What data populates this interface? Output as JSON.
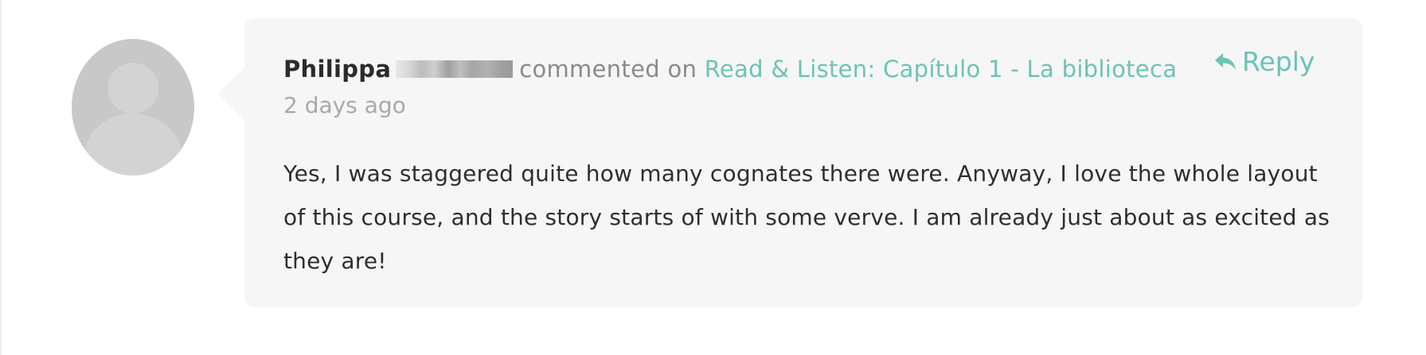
{
  "comment": {
    "author_first_name": "Philippa",
    "commented_on_text": "commented on",
    "lesson_link_text": "Read & Listen: Capítulo 1 - La biblioteca",
    "timestamp": "2 days ago",
    "body": "Yes, I was staggered quite how many cognates there were. Anyway, I love the whole layout of this course, and the story starts of with some verve. I am already just about as excited as they are!",
    "reply_label": "Reply"
  },
  "icons": {
    "avatar": "default-user-silhouette",
    "reply": "reply-arrow-icon"
  },
  "colors": {
    "accent": "#6cc3b6",
    "author": "#2b2b2b",
    "muted": "#8a8a8a",
    "timestamp": "#a9a9a9",
    "bubble_background": "#f6f6f6",
    "avatar_background": "#c8c8c8"
  }
}
